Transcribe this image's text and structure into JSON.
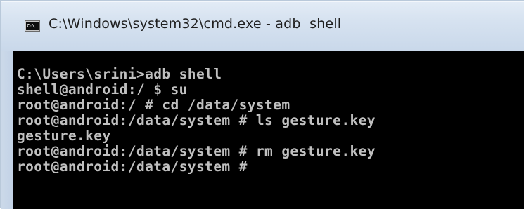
{
  "window": {
    "title": "C:\\Windows\\system32\\cmd.exe - adb  shell",
    "icon": "cmd-icon",
    "icon_label": "C:\\"
  },
  "console": {
    "lines": [
      "C:\\Users\\srini>adb shell",
      "shell@android:/ $ su",
      "root@android:/ # cd /data/system",
      "root@android:/data/system # ls gesture.key",
      "gesture.key",
      "root@android:/data/system # rm gesture.key",
      "root@android:/data/system #"
    ]
  },
  "colors": {
    "console_background": "#000000",
    "console_text": "#c0c0c0",
    "titlebar": "#d6e2f0"
  }
}
